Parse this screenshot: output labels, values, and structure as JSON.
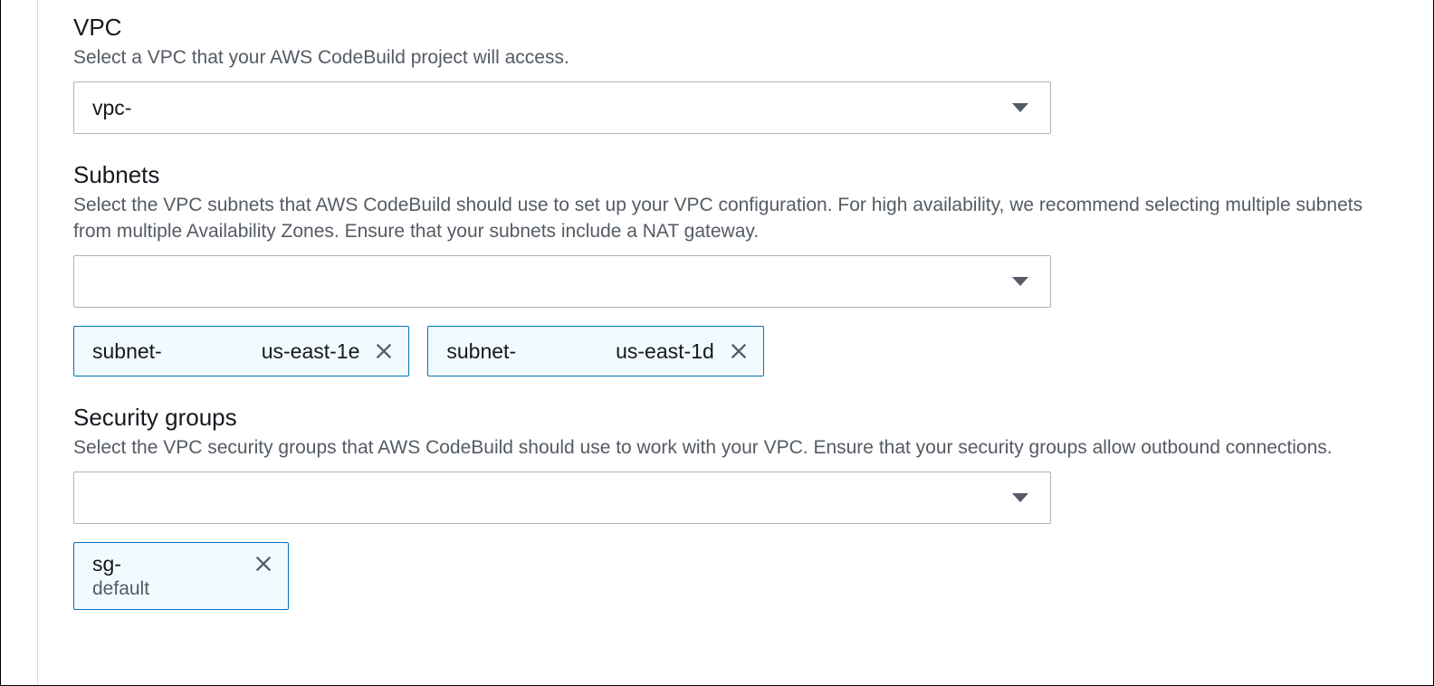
{
  "vpc": {
    "title": "VPC",
    "description": "Select a VPC that your AWS CodeBuild project will access.",
    "selected": "vpc-"
  },
  "subnets": {
    "title": "Subnets",
    "description": "Select the VPC subnets that AWS CodeBuild should use to set up your VPC configuration. For high availability, we recommend selecting multiple subnets from multiple Availability Zones. Ensure that your subnets include a NAT gateway.",
    "selected": "",
    "chips": [
      {
        "prefix": "subnet-",
        "az": "us-east-1e"
      },
      {
        "prefix": "subnet-",
        "az": "us-east-1d"
      }
    ]
  },
  "securityGroups": {
    "title": "Security groups",
    "description": "Select the VPC security groups that AWS CodeBuild should use to work with your VPC. Ensure that your security groups allow outbound connections.",
    "selected": "",
    "chips": [
      {
        "id": "sg-",
        "name": "default"
      }
    ]
  }
}
